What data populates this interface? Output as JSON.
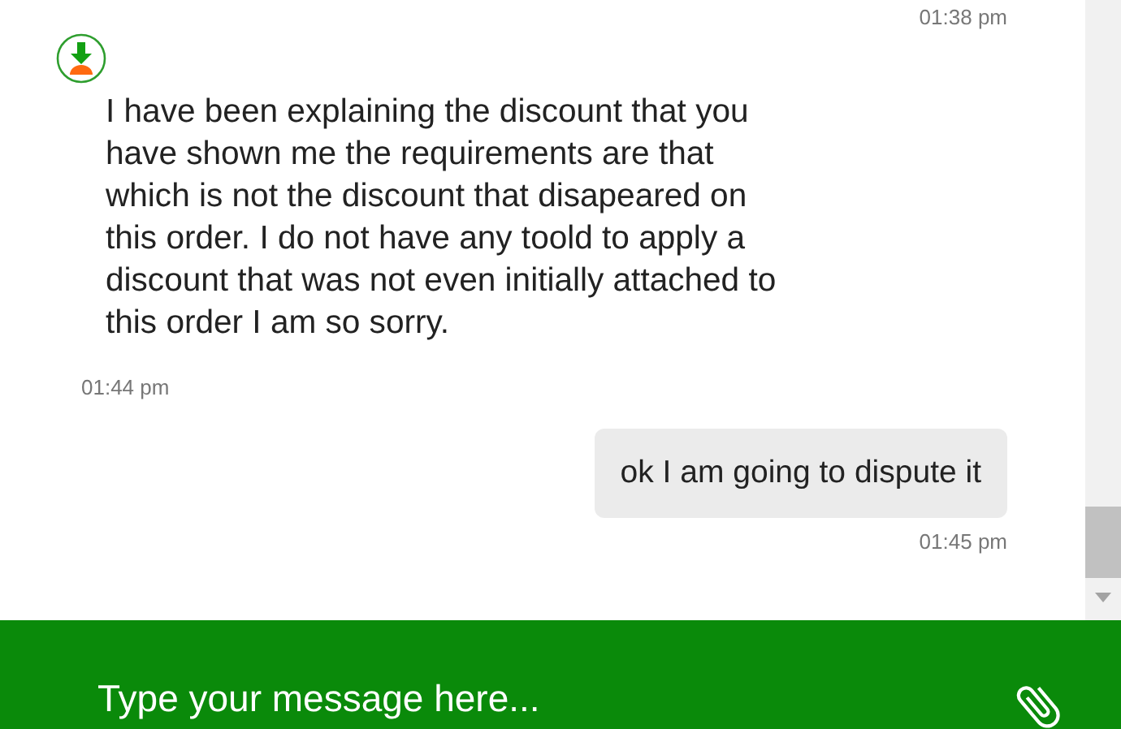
{
  "messages": [
    {
      "kind": "outgoing",
      "time": "01:38 pm"
    },
    {
      "kind": "incoming",
      "text": "I have been explaining the discount that you have shown me the requirements are that which is not the discount that disapeared on this order. I do not have any toold to apply a discount that was not even initially attached to this order I am so sorry.",
      "time": "01:44 pm"
    },
    {
      "kind": "outgoing",
      "text": "ok I am going to dispute it",
      "time": "01:45 pm"
    }
  ],
  "composer": {
    "placeholder": "Type your message here..."
  }
}
